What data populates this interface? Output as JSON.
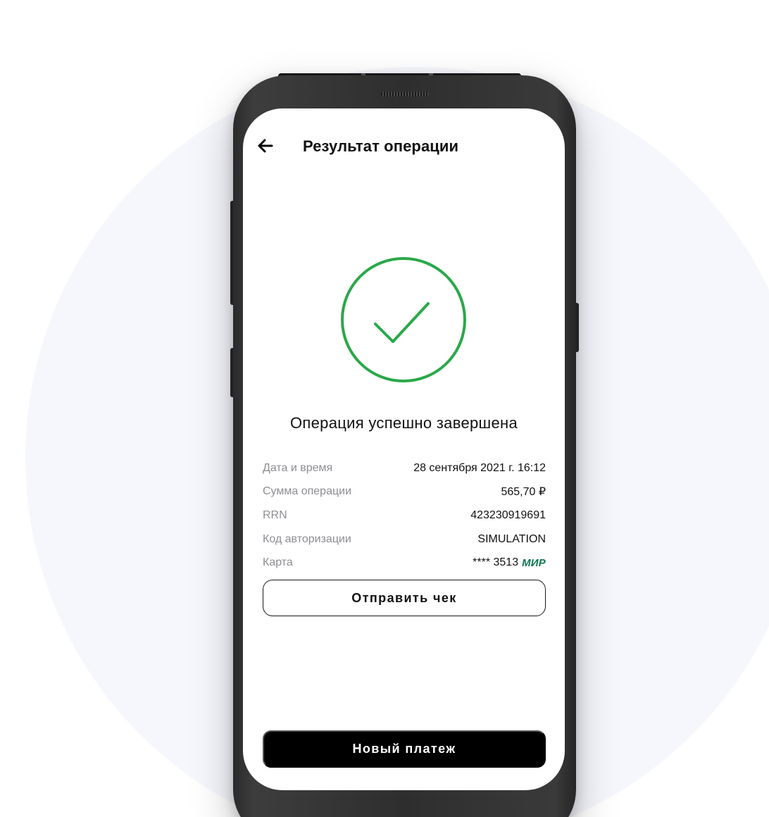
{
  "header": {
    "back_icon": "arrow-left-icon",
    "title": "Результат операции"
  },
  "status": {
    "icon": "check-circle-icon",
    "text": "Операция успешно завершена",
    "color": "#2aa84a"
  },
  "details": [
    {
      "label": "Дата и время",
      "value": "28 сентября 2021 г. 16:12"
    },
    {
      "label": "Сумма операции",
      "value": "565,70 ₽"
    },
    {
      "label": "RRN",
      "value": "423230919691"
    },
    {
      "label": "Код авторизации",
      "value": "SIMULATION"
    },
    {
      "label": "Карта",
      "value": "**** 3513",
      "brand": "МИР",
      "brand_color": "#0f754e"
    }
  ],
  "actions": {
    "send_receipt": "Отправить чек",
    "new_payment": "Новый платеж"
  }
}
